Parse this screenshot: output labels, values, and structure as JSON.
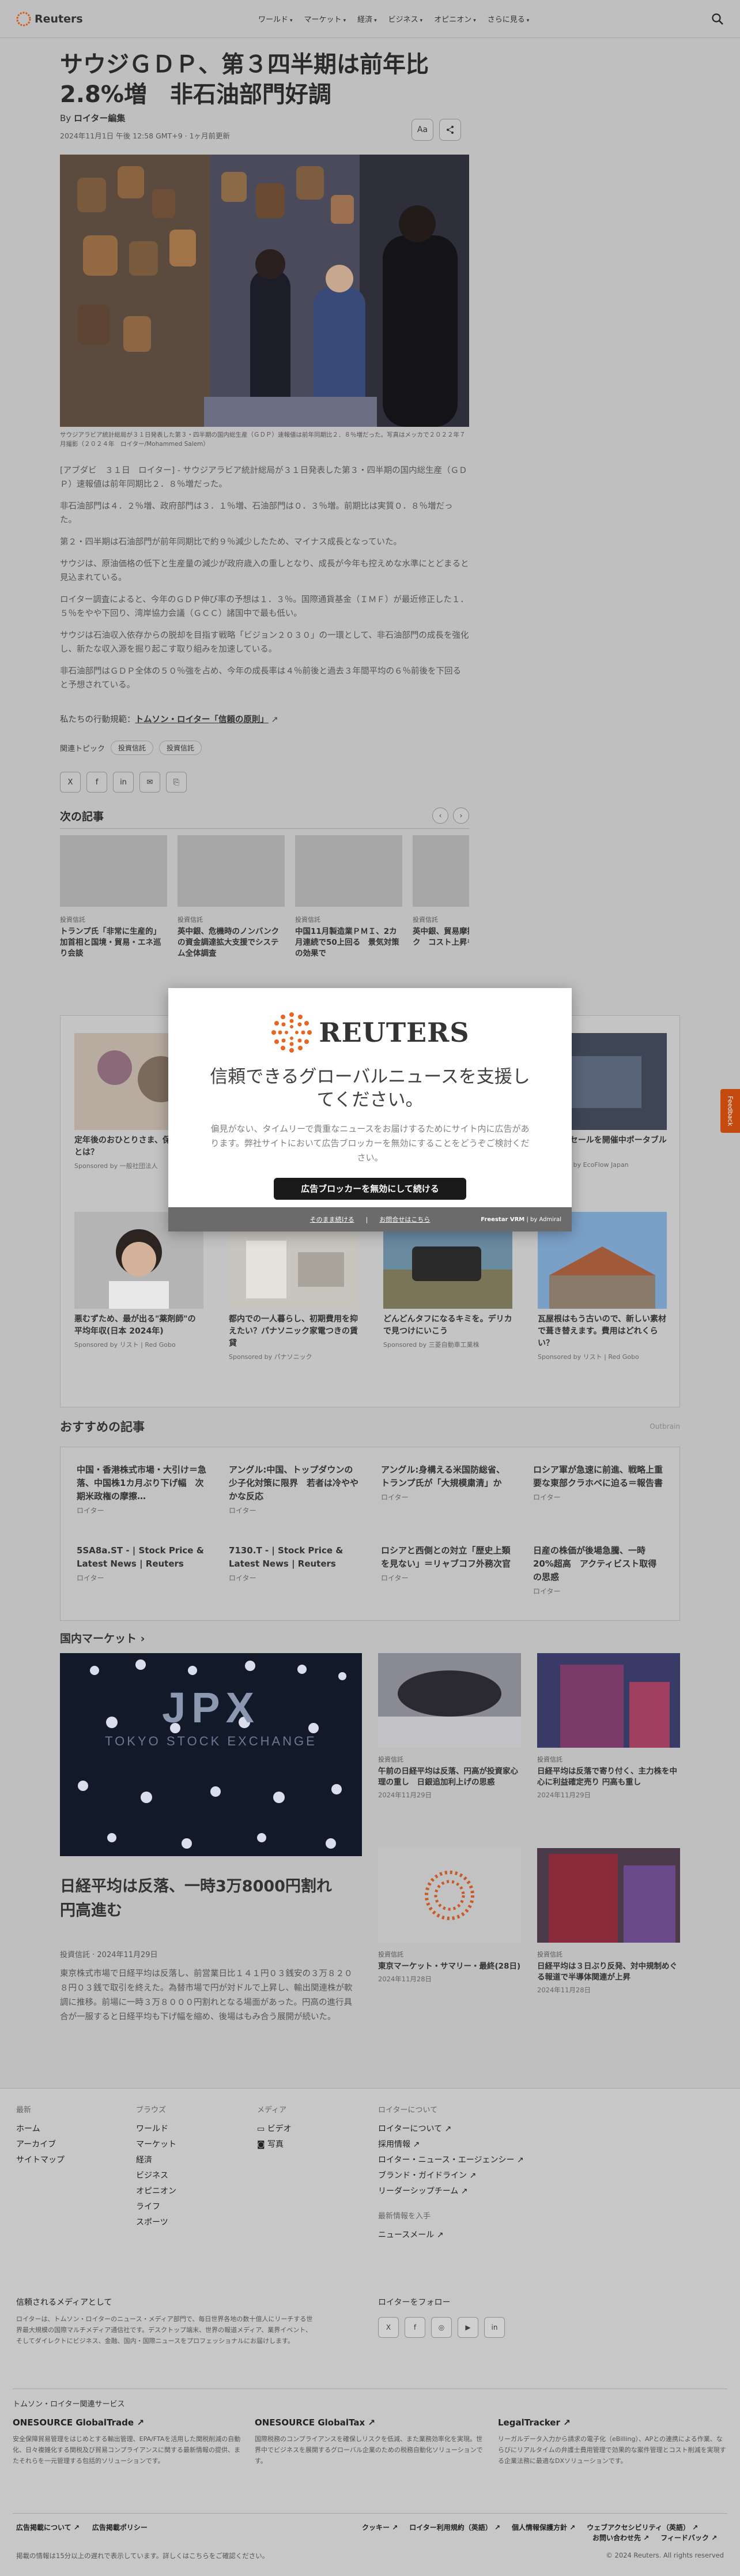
{
  "header": {
    "logo": "Reuters",
    "nav": [
      "ワールド",
      "マーケット",
      "経済",
      "ビジネス",
      "オピニオン",
      "さらに見る"
    ]
  },
  "article": {
    "title": "サウジＧＤＰ、第３四半期は前年比2.8%増　非石油部門好調",
    "byline_prefix": "By",
    "byline": "ロイター編集",
    "date": "2024年11月1日 午後 12:58 GMT+9 · 1ヶ月前更新",
    "text_size_label": "Aa",
    "caption": "サウジアラビア統計総局が３１日発表した第３・四半期の国内総生産（ＧＤＰ）速報値は前年同期比２．８％増だった。写真はメッカで２０２２年７月撮影（２０２４年　ロイター/Mohammed Salem）",
    "paragraphs": [
      "[アブダビ　３１日　ロイター] - サウジアラビア統計総局が３１日発表した第３・四半期の国内総生産（ＧＤＰ）速報値は前年同期比２．８％増だった。",
      "非石油部門は４．２％増、政府部門は３．１％増、石油部門は０．３％増。前期比は実質０．８％増だった。",
      "第２・四半期は石油部門が前年同期比で約９％減少したため、マイナス成長となっていた。",
      "サウジは、原油価格の低下と生産量の減少が政府歳入の重しとなり、成長が今年も控えめな水準にとどまると見込まれている。",
      "ロイター調査によると、今年のＧＤＰ伸び率の予想は１．３％。国際通貨基金（ＩＭＦ）が最近修正した１．５％をやや下回り、湾岸協力会議（ＧＣＣ）諸国中で最も低い。",
      "サウジは石油収入依存からの脱却を目指す戦略「ビジョン２０３０」の一環として、非石油部門の成長を強化し、新たな収入源を掘り起こす取り組みを加速している。",
      "非石油部門はＧＤＰ全体の５０％強を占め、今年の成長率は４％前後と過去３年間平均の６％前後を下回ると予想されている。"
    ],
    "principles_prefix": "私たちの行動規範：",
    "principles_link": "トムソン・ロイター「信頼の原則」",
    "topics_label": "関連トピック",
    "topics": [
      "投資信託",
      "投資信託"
    ],
    "share": [
      "X",
      "f",
      "in",
      "✉",
      "⎘"
    ]
  },
  "next": {
    "title": "次の記事",
    "items": [
      {
        "cat": "投資信託",
        "title": "トランプ氏「非常に生産的」加首相と国境・貿易・エネ巡り会談"
      },
      {
        "cat": "投資信託",
        "title": "英中銀、危機時のノンバンクの資金調達拡大支援でシステム全体調査"
      },
      {
        "cat": "投資信託",
        "title": "中国11月製造業ＰＭＩ、2カ月連続で50上回る　景気対策の効果で"
      },
      {
        "cat": "投資信託",
        "title": "英中銀、貿易摩擦によるリスク　コスト上昇も"
      }
    ]
  },
  "ads": [
    {
      "title": "定年後のおひとりさま、保証の対策とは？",
      "sponsor": "Sponsored by 一般社団法人"
    },
    {
      "title": "本タイムセールを開催中ポータブル電源が",
      "sponsor": "Sponsored by EcoFlow Japan"
    },
    {
      "title": "悪むずため、最が出る\"薬剤師\"の平均年収(日本 2024年)",
      "sponsor": "Sponsored by リスト | Red Gobo"
    },
    {
      "title": "都内での一人暮らし、初期費用を抑えたい？パナソニック家電つきの賃貸",
      "sponsor": "Sponsored by パナソニック"
    },
    {
      "title": "どんどんタフになるキミを。デリカで見つけにいこう",
      "sponsor": "Sponsored by 三菱自動車工業株"
    },
    {
      "title": "瓦屋根はもう古いので、新しい素材で葺き替えます。費用はどれくらい？",
      "sponsor": "Sponsored by リスト | Red Gobo"
    }
  ],
  "modal": {
    "logo": "REUTERS",
    "heading": "信頼できるグローバルニュースを支援してください。",
    "text": "偏見がない、タイムリーで貴重なニュースをお届けするためにサイト内に広告があります。弊社サイトにおいて広告ブロッカーを無効にすることをどうぞご検討ください。",
    "button": "広告ブロッカーを無効にして続ける",
    "link1": "そのまま続ける",
    "link2": "お問合せはこちら",
    "brand": "Freestar VRM",
    "brand2": "by Admiral"
  },
  "feedback": "Feedback",
  "recommended": {
    "title": "おすすめの記事",
    "provider": "Outbrain",
    "items": [
      {
        "title": "中国・香港株式市場・大引け＝急落、中国株1カ月ぶり下げ幅　次期米政権の摩擦…",
        "src": "ロイター"
      },
      {
        "title": "アングル:中国、トップダウンの少子化対策に限界　若者は冷ややかな反応",
        "src": "ロイター"
      },
      {
        "title": "アングル:身構える米国防総省、トランプ氏が「大規模粛清」か",
        "src": "ロイター"
      },
      {
        "title": "ロシア軍が急速に前進、戦略上重要な東部クラホベに迫る＝報告書",
        "src": "ロイター"
      },
      {
        "title": "5SA8a.ST - | Stock Price & Latest News | Reuters",
        "src": "ロイター"
      },
      {
        "title": "7130.T - | Stock Price & Latest News | Reuters",
        "src": "ロイター"
      },
      {
        "title": "ロシアと西側との対立「歴史上類を見ない」＝リャブコフ外務次官",
        "src": "ロイター"
      },
      {
        "title": "日産の株価が後場急騰、一時20%超高　アクティビスト取得の思惑",
        "src": "ロイター"
      }
    ]
  },
  "markets": {
    "title": "国内マーケット",
    "lead": {
      "title": "日経平均は反落、一時3万8000円割れ　円高進む",
      "date": "投資信託 · 2024年11月29日",
      "text": "東京株式市場で日経平均は反落し、前営業日比１４１円０３銭安の３万８２０８円０３銭で取引を終えた。為替市場で円が対ドルで上昇し、輸出関連株が軟調に推移。前場に一時３万８０００円割れとなる場面があった。円高の進行具合が一服すると日経平均も下げ幅を縮め、後場はもみ合う展開が続いた。"
    },
    "items": [
      {
        "cat": "投資信託",
        "title": "午前の日経平均は反落、円高が投資家心理の重し　日銀追加利上げの思惑",
        "date": "2024年11月29日"
      },
      {
        "cat": "投資信託",
        "title": "日経平均は反落で寄り付く、主力株を中心に利益確定売り 円高も重し",
        "date": "2024年11月29日"
      },
      {
        "cat": "投資信託",
        "title": "東京マーケット・サマリー・最終(28日)",
        "date": "2024年11月28日"
      },
      {
        "cat": "投資信託",
        "title": "日経平均は３日ぶり反発、対中規制めぐる報道で半導体関連が上昇",
        "date": "2024年11月28日"
      }
    ]
  },
  "footer": {
    "col1": {
      "items": [
        "ホーム",
        "アーカイブ",
        "サイトマップ"
      ],
      "head": "最新"
    },
    "col2": {
      "head": "ブラウズ",
      "items": [
        "ワールド",
        "マーケット",
        "経済",
        "ビジネス",
        "オピニオン",
        "ライフ",
        "スポーツ"
      ]
    },
    "col3": {
      "head": "メディア",
      "items": [
        "ビデオ",
        "写真"
      ]
    },
    "col4": {
      "head": "ロイターについて",
      "items": [
        "ロイターについて",
        "採用情報",
        "ロイター・ニュース・エージェンシー",
        "ブランド・ガイドライン",
        "リーダーシップチーム"
      ],
      "head2": "最新情報を入手",
      "items2": [
        "ニュースメール"
      ]
    },
    "trust_title": "信頼されるメディアとして",
    "trust_text": "ロイターは、トムソン・ロイターのニュース・メディア部門で、毎日世界各地の数十億人にリーチする世界最大規模の国際マルチメディア通信社です。デスクトップ端末、世界の報道メディア、業界イベント、そしてダイレクトにビジネス、金融、国内・国際ニュースをプロフェッショナルにお届けします。",
    "follow": "ロイターをフォロー",
    "social": [
      "X",
      "f",
      "◎",
      "▶",
      "in"
    ],
    "services_title": "トムソン・ロイター関連サービス",
    "services": [
      {
        "name": "ONESOURCE GlobalTrade",
        "text": "安全保障貿易管理をはじめとする輸出管理、EPA/FTAを活用した関税削減の自動化、日々複雑化する関税及び貿易コンプライアンスに関する最新情報の提供、またそれらを一元管理する包括的ソリューションです。"
      },
      {
        "name": "ONESOURCE GlobalTax",
        "text": "国際税務のコンプライアンスを確保しリスクを低減、また業務効率化を実現。世界中でビジネスを展開するグローバル企業のための税務自動化ソリューションです。"
      },
      {
        "name": "LegalTracker",
        "text": "リーガルデータ入力から請求の電子化（eBilling）、APとの連携による作業、ならびにリアルタイムの弁護士費用管理で効果的な案件管理とコスト削減を実現する企業法務に最適なDXソリューションです。"
      }
    ],
    "legal_left": [
      "広告掲載について",
      "広告掲載ポリシー"
    ],
    "legal_right": [
      "クッキー",
      "ロイター利用規約（英語）",
      "個人情報保護方針",
      "ウェブアクセシビリティ（英語）"
    ],
    "legal_right2": [
      "お問い合わせ先",
      "フィードバック"
    ],
    "disclaimer": "掲載の情報は15分以上の遅れで表示しています。詳しくはこちらをご確認ください。",
    "copyright": "© 2024 Reuters. All rights reserved"
  }
}
